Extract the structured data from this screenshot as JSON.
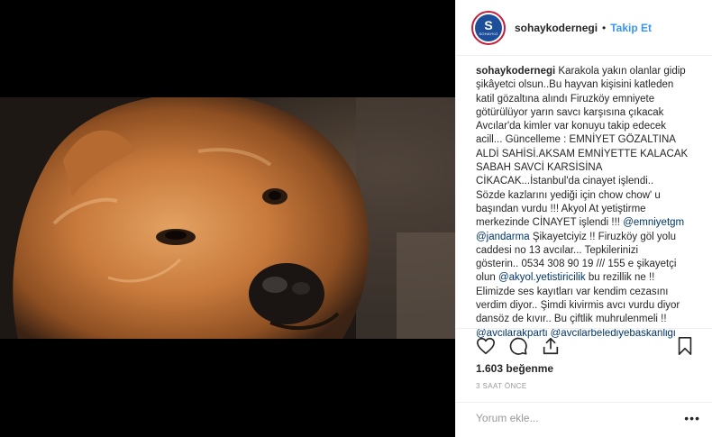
{
  "post": {
    "photo_alt": "chow chow dog",
    "header": {
      "username": "sohaykodernegi",
      "separator": "•",
      "follow_label": "Takip Et",
      "avatar_mark": "S",
      "avatar_caption": "SOHAYKO"
    },
    "caption": {
      "username": "sohaykodernegi",
      "lines": [
        "Karakola yakın olanlar gidip",
        "şikâyetci olsun..Bu hayvan kişisini katleden",
        "katil gözaltına alındı Firuzköy emniyete",
        "götürülüyor yarın savcı karşısına çıkacak",
        "Avcılar'da kimler var konuyu takip edecek",
        "acill... Güncelleme : EMNİYET GÖZALTINA",
        "ALDİ SAHİSİ.AKSAM EMNİYETTE KALACAK",
        "SABAH SAVCİ KARSİSİNA",
        "CİKACAK...İstanbul'da cinayet işlendi..",
        "Sözde kazlarını yediği için chow chow' u",
        "başından vurdu !!! Akyol At yetiştirme",
        "merkezinde CİNAYET işlendi !!!",
        "Şikayetciyiz !! Firuzköy göl yolu",
        "caddesi no 13 avcılar... Tepkilerinizi",
        "gösterin.. 0534 308 90 19 /// 155 e şikayetçi",
        "olun",
        "bu rezillik ne !!",
        "Elimizde ses kayıtları var kendim cezasını",
        "verdim diyor.. Şimdi kivirmis avcı vurdu diyor",
        "dansöz de kıvır.. Bu çiftlik muhrulenmeli !!"
      ],
      "mentions": [
        "@emniyetgm",
        "@jandarma",
        "@akyol.yetistiricilik",
        "@avcilarakparti",
        "@avcilarbelediyebaskanligi"
      ]
    },
    "actions": {
      "like_icon": "heart-icon",
      "comment_icon": "comment-icon",
      "share_icon": "share-icon",
      "save_icon": "bookmark-icon"
    },
    "likes_text": "1.603 beğenme",
    "timestamp": "3 SAAT ÖNCE",
    "comment_placeholder": "Yorum ekle...",
    "more_label": "•••"
  },
  "colors": {
    "link_blue": "#3897f0",
    "mention_blue": "#003569",
    "avatar_ring": "#c41e3a",
    "avatar_fill": "#1d4e9a"
  }
}
